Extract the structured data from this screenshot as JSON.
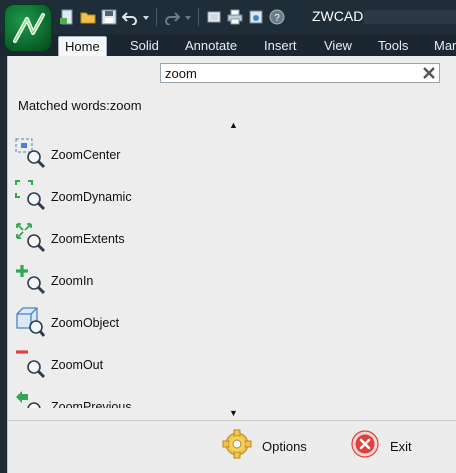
{
  "window": {
    "title": "ZWCAD"
  },
  "ribbon": {
    "tabs": [
      {
        "label": "Home",
        "active": true
      },
      {
        "label": "Solid"
      },
      {
        "label": "Annotate"
      },
      {
        "label": "Insert"
      },
      {
        "label": "View"
      },
      {
        "label": "Tools"
      },
      {
        "label": "Mar"
      }
    ]
  },
  "search": {
    "value": "zoom"
  },
  "matched": {
    "prefix": "Matched words:",
    "term": "zoom"
  },
  "results": [
    {
      "label": "ZoomCenter",
      "icon": "zoom-center-icon"
    },
    {
      "label": "ZoomDynamic",
      "icon": "zoom-dynamic-icon"
    },
    {
      "label": "ZoomExtents",
      "icon": "zoom-extents-icon"
    },
    {
      "label": "ZoomIn",
      "icon": "zoom-in-icon"
    },
    {
      "label": "ZoomObject",
      "icon": "zoom-object-icon"
    },
    {
      "label": "ZoomOut",
      "icon": "zoom-out-icon"
    },
    {
      "label": "ZoomPrevious",
      "icon": "zoom-previous-icon"
    }
  ],
  "footer": {
    "options_label": "Options",
    "exit_label": "Exit"
  },
  "colors": {
    "titlebar": "#1f2d38",
    "panel": "#ededed",
    "accent_green": "#2fa84f",
    "exit_red": "#e0403a"
  }
}
